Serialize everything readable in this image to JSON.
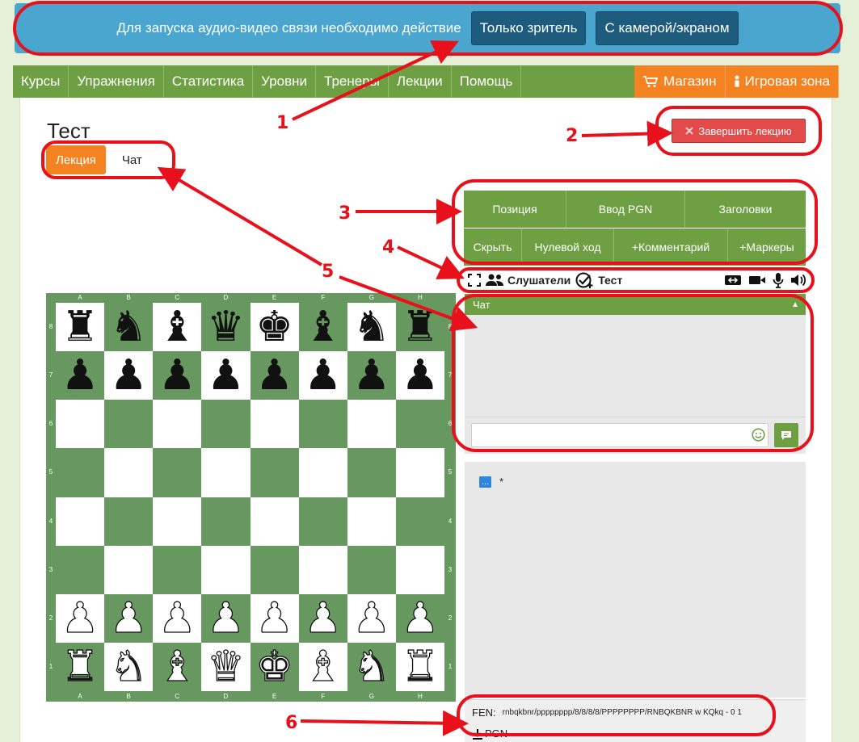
{
  "banner": {
    "message": "Для запуска аудио-видео связи необходимо действие",
    "viewer_button": "Только зритель",
    "camera_button": "С камерой/экраном"
  },
  "nav": {
    "items": [
      "Курсы",
      "Упражнения",
      "Статистика",
      "Уровни",
      "Тренеры",
      "Лекции",
      "Помощь"
    ],
    "shop": "Магазин",
    "game_zone": "Игровая зона"
  },
  "lecture": {
    "title": "Тест",
    "tabs": [
      "Лекция",
      "Чат"
    ],
    "end_button": "Завершить лекцию"
  },
  "toolbar": {
    "row1": [
      "Позиция",
      "Ввод PGN",
      "Заголовки"
    ],
    "row2": [
      "Скрыть",
      "Нулевой ход",
      "+Комментарий",
      "+Маркеры"
    ]
  },
  "icon_row": {
    "listeners": "Слушатели",
    "test": "Тест"
  },
  "chat": {
    "header": "Чат",
    "collapse_glyph": "▲",
    "input_value": ""
  },
  "moves": {
    "chip": "...",
    "result": "*"
  },
  "fen": {
    "label": "FEN:",
    "value": "rnbqkbnr/pppppppp/8/8/8/8/PPPPPPPP/RNBQKBNR w KQkq - 0 1"
  },
  "pgn": {
    "label": "PGN"
  },
  "board": {
    "files": [
      "A",
      "B",
      "C",
      "D",
      "E",
      "F",
      "G",
      "H"
    ],
    "ranks": [
      "8",
      "7",
      "6",
      "5",
      "4",
      "3",
      "2",
      "1"
    ],
    "rows": [
      "rnbqkbnr",
      "pppppppp",
      "........",
      "........",
      "........",
      "........",
      "PPPPPPPP",
      "RNBQKBNR"
    ],
    "light_color": "#ffffff",
    "dark_color": "#669860"
  },
  "annotations": [
    "1",
    "2",
    "3",
    "4",
    "5",
    "6"
  ],
  "colors": {
    "nav_green": "#6ea043",
    "accent_orange": "#f58220",
    "banner_blue": "#4aa6cf",
    "annotation_red": "#e8101a",
    "end_red": "#e34a4a"
  }
}
